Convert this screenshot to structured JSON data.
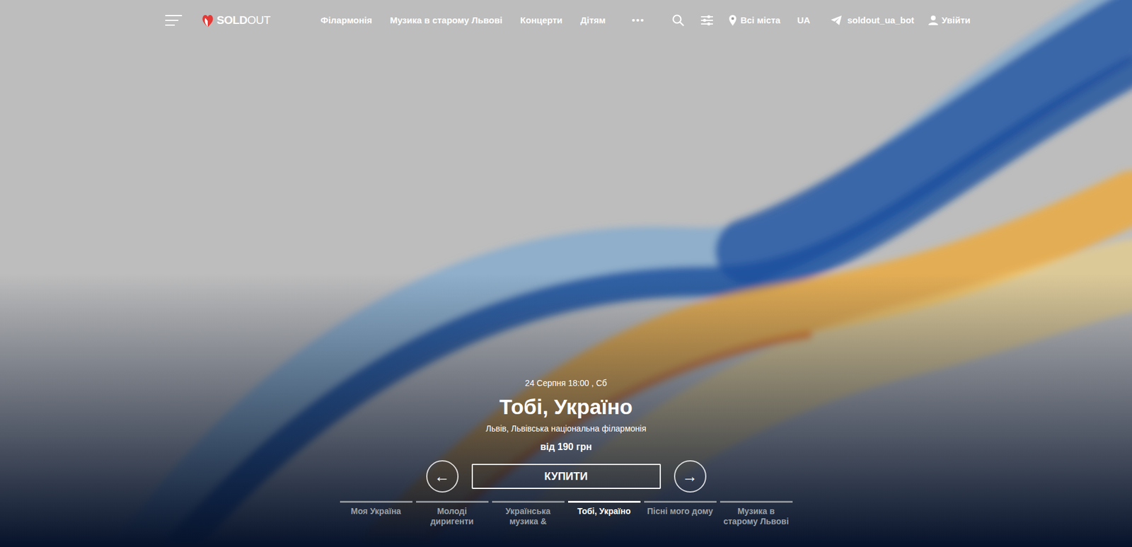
{
  "nav": {
    "menu_icon": true,
    "logo": {
      "bold": "SOLD",
      "light": "OUT"
    },
    "links": [
      "Філармонія",
      "Музика в старому Львові",
      "Концерти",
      "Дітям"
    ],
    "more": "•••",
    "location": "Всі міста",
    "language": "UA",
    "telegram": "soldout_ua_bot",
    "login": "Увійти"
  },
  "hero": {
    "date": "24 Серпня 18:00 , Сб",
    "title": "Тобі, Україно",
    "venue": "Львів, Львівська національна філармонія",
    "price": "від 190 грн",
    "buy": "КУПИТИ",
    "prev": "←",
    "next": "→"
  },
  "slides": [
    {
      "label": "Моя Україна",
      "selected": false
    },
    {
      "label": "Молоді диригенти",
      "selected": false
    },
    {
      "label": "Українська музика &",
      "selected": false
    },
    {
      "label": "Тобі, Україно",
      "selected": true
    },
    {
      "label": "Пісні мого дому",
      "selected": false
    },
    {
      "label": "Музика в старому Львові",
      "selected": false
    }
  ]
}
